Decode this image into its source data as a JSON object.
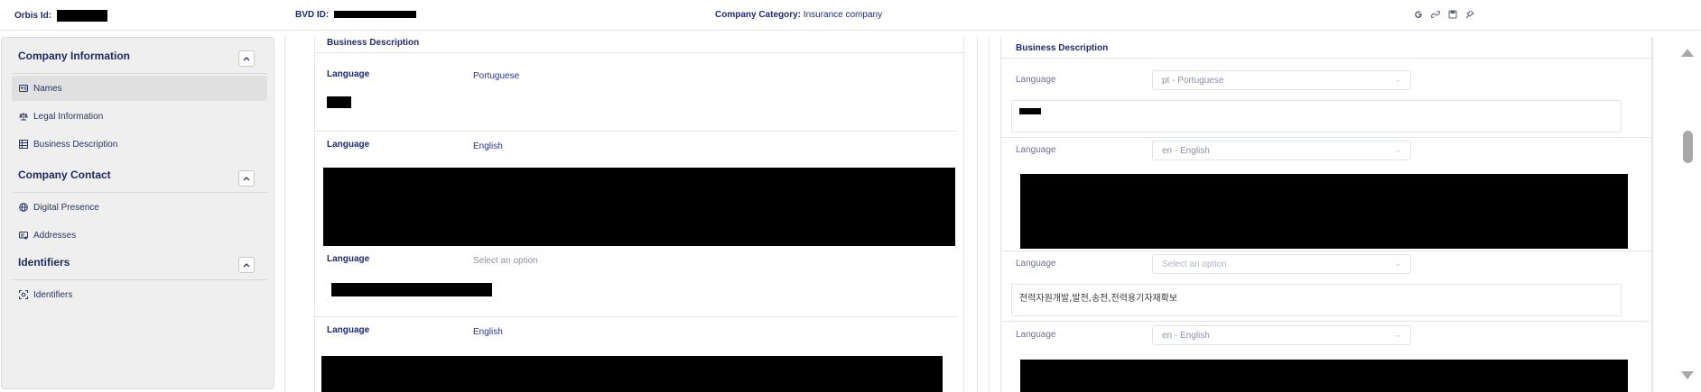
{
  "topbar": {
    "orbis_label": "Orbis Id:",
    "bvd_label": "BVD ID:",
    "category_label": "Company Category:",
    "category_value": "Insurance company",
    "icons": [
      "google-icon",
      "link-icon",
      "save-icon",
      "pin-icon"
    ]
  },
  "sidebar": {
    "sections": [
      {
        "title": "Company Information",
        "items": [
          {
            "label": "Names",
            "icon": "id-card-icon",
            "active": true
          },
          {
            "label": "Legal Information",
            "icon": "scale-icon"
          },
          {
            "label": "Business Description",
            "icon": "table-icon"
          }
        ]
      },
      {
        "title": "Company Contact",
        "items": [
          {
            "label": "Digital Presence",
            "icon": "globe-icon"
          },
          {
            "label": "Addresses",
            "icon": "address-card-icon"
          }
        ]
      },
      {
        "title": "Identifiers",
        "items": [
          {
            "label": "Identifiers",
            "icon": "scan-icon"
          }
        ]
      }
    ]
  },
  "left_panel": {
    "title": "Business Description",
    "entries": [
      {
        "label": "Language",
        "value": "Portuguese"
      },
      {
        "label": "Language",
        "value": "English"
      },
      {
        "label": "Language",
        "value": "Select an option",
        "placeholder": true
      },
      {
        "label": "Language",
        "value": "English"
      }
    ]
  },
  "right_panel": {
    "title": "Business Description",
    "entries": [
      {
        "label": "Language",
        "select": "pt - Portuguese"
      },
      {
        "label": "Language",
        "select": "en - English"
      },
      {
        "label": "Language",
        "select": "Select an option",
        "text": "전력자원개발,발전,송전,전력용기자재확보"
      },
      {
        "label": "Language",
        "select": "en - English"
      }
    ]
  },
  "colors": {
    "accent": "#1f2a6e",
    "redaction": "#000000",
    "sidebar_bg": "#efefef"
  }
}
